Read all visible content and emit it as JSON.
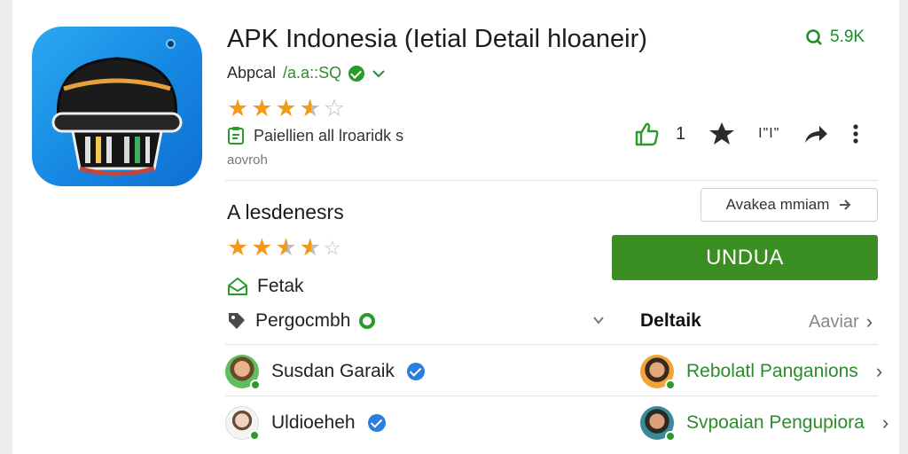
{
  "app": {
    "title": "APK Indonesia (Ietial Detail hloaneir)",
    "rating_badge": "5.9K",
    "developer_prefix": "Abpcal ",
    "developer_highlight": "/a.a::SQ",
    "tag_text": "Paiellien all lroaridk s",
    "sub_text": "aovroh",
    "stars_top": 3.5
  },
  "actions": {
    "like_count": "1",
    "star_count": "I\"I\""
  },
  "section": {
    "heading": "A lesdenesrs",
    "stars": 3.5,
    "more_button": "Avakea mmiam",
    "download_button": "UNDUA",
    "feature_label": "Fetak",
    "category_label": "Pergocmbh"
  },
  "detail": {
    "heading": "Deltaik",
    "link": "Aaviar"
  },
  "users_left": [
    {
      "name": "Susdan Garaik"
    },
    {
      "name": "Uldioeheh"
    }
  ],
  "users_right": [
    {
      "name": "Rebolatl Panganions"
    },
    {
      "name": "Svpoaian Pengupiora"
    }
  ],
  "colors": {
    "accent_green": "#3a8e22",
    "star_orange": "#f29a19",
    "icon_blue": "#1687e2",
    "verified_blue": "#2a7de1"
  },
  "icons": {
    "app_icon": "helmet-icon",
    "search": "search-icon",
    "like": "thumbs-up-icon",
    "star": "star-icon",
    "share": "share-icon",
    "more": "more-vert-icon"
  }
}
